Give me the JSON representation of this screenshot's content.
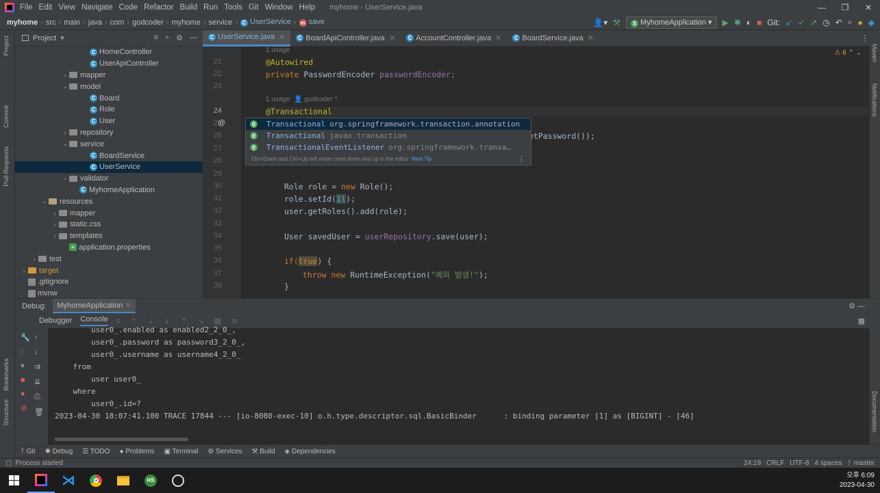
{
  "titlebar": {
    "menu": [
      "File",
      "Edit",
      "View",
      "Navigate",
      "Code",
      "Refactor",
      "Build",
      "Run",
      "Tools",
      "Git",
      "Window",
      "Help"
    ],
    "window_title": "myhome - UserService.java"
  },
  "breadcrumbs": [
    "myhome",
    "src",
    "main",
    "java",
    "com",
    "godcoder",
    "myhome",
    "service",
    "UserService",
    "save"
  ],
  "toolbar": {
    "run_config": "MyhomeApplication",
    "git_label": "Git:"
  },
  "left_stripe": {
    "project": "Project",
    "commit": "Commit",
    "pull_requests": "Pull Requests",
    "bookmarks": "Bookmarks",
    "structure": "Structure"
  },
  "right_stripe": {
    "maven": "Maven",
    "notifications": "Notifications",
    "documentation": "Documentation"
  },
  "project_panel": {
    "title": "Project",
    "items": [
      {
        "label": "HomeController",
        "icon": "class",
        "indent": 7
      },
      {
        "label": "UserApiController",
        "icon": "class",
        "indent": 7
      },
      {
        "label": "mapper",
        "icon": "folder",
        "indent": 5,
        "arrow": "›"
      },
      {
        "label": "model",
        "icon": "folder",
        "indent": 5,
        "arrow": "⌄"
      },
      {
        "label": "Board",
        "icon": "class",
        "indent": 7
      },
      {
        "label": "Role",
        "icon": "class",
        "indent": 7
      },
      {
        "label": "User",
        "icon": "class",
        "indent": 7
      },
      {
        "label": "repository",
        "icon": "folder",
        "indent": 5,
        "arrow": "›"
      },
      {
        "label": "service",
        "icon": "folder",
        "indent": 5,
        "arrow": "⌄"
      },
      {
        "label": "BoardService",
        "icon": "class",
        "indent": 7
      },
      {
        "label": "UserService",
        "icon": "class",
        "indent": 7,
        "selected": true
      },
      {
        "label": "validator",
        "icon": "folder",
        "indent": 5,
        "arrow": "›"
      },
      {
        "label": "MyhomeApplication",
        "icon": "app",
        "indent": 6
      },
      {
        "label": "resources",
        "icon": "resfolder",
        "indent": 3,
        "arrow": "⌄"
      },
      {
        "label": "mapper",
        "icon": "folder",
        "indent": 4,
        "arrow": "›"
      },
      {
        "label": "static.css",
        "icon": "folder",
        "indent": 4,
        "arrow": "›"
      },
      {
        "label": "templates",
        "icon": "folder",
        "indent": 4,
        "arrow": "›"
      },
      {
        "label": "application.properties",
        "icon": "props",
        "indent": 5
      },
      {
        "label": "test",
        "icon": "folder",
        "indent": 2,
        "arrow": "›"
      },
      {
        "label": "target",
        "icon": "tgtfolder",
        "indent": 1,
        "arrow": "›"
      },
      {
        "label": ".gitignore",
        "icon": "file",
        "indent": 1
      },
      {
        "label": "mvnw",
        "icon": "file",
        "indent": 1
      }
    ]
  },
  "editor": {
    "tabs": [
      {
        "label": "UserService.java",
        "active": true
      },
      {
        "label": "BoardApiController.java"
      },
      {
        "label": "AccountController.java"
      },
      {
        "label": "BoardService.java"
      }
    ],
    "warnings": "6",
    "hint_usage": "1 usage",
    "hint_usage2": "1 usage",
    "hint_author": "godcoder *",
    "line_numbers": [
      "21",
      "22",
      "23",
      "24",
      "25",
      "26",
      "27",
      "28",
      "29",
      "30",
      "31",
      "32",
      "33",
      "34",
      "35",
      "36",
      "37",
      "38"
    ],
    "code": {
      "l21": "@Autowired",
      "l22_kw": "private ",
      "l22_type": "PasswordEncoder ",
      "l22_field": "passwordEncoder;",
      "l24": "@Transactional",
      "l26_tail": "etPassword());",
      "l30_a": "Role role = ",
      "l30_kw": "new ",
      "l30_b": "Role();",
      "l31_a": "role.setId(",
      "l31_num": "1l",
      "l31_b": ");",
      "l32": "user.getRoles().add(role);",
      "l34_a": "User savedUser = ",
      "l34_field": "userRepository",
      "l34_b": ".save(user);",
      "l36_kw": "if(",
      "l36_kw2": "true",
      "l36_b": ") {",
      "l37_kw": "throw new ",
      "l37_a": "RuntimeException(",
      "l37_str": "\"예외 발생!\"",
      "l37_b": ");",
      "l38": "}"
    }
  },
  "completion_popup": {
    "items": [
      {
        "name": "Transactional",
        "pkg": "org.springframework.transaction.annotation",
        "selected": true
      },
      {
        "name": "Transactional",
        "pkg": "javax.transaction"
      },
      {
        "name": "TransactionalEventListener",
        "pkg": "org.springframework.transa…"
      }
    ],
    "footer": "Ctrl+Down and Ctrl+Up will move caret down and up in the editor",
    "next_tip": "Next Tip"
  },
  "debug": {
    "label": "Debug:",
    "config": "MyhomeApplication",
    "tabs": [
      "Debugger",
      "Console"
    ],
    "console_lines": [
      "        user0_.enabled as enabled2_2_0_,",
      "        user0_.password as password3_2_0_,",
      "        user0_.username as username4_2_0_",
      "    from",
      "        user user0_",
      "    where",
      "        user0_.id=?",
      "2023-04-30 18:07:41.100 TRACE 17844 --- [io-8080-exec-10] o.h.type.descriptor.sql.BasicBinder      : binding parameter [1] as [BIGINT] - [46]"
    ]
  },
  "bottom_tabs": [
    "Git",
    "Debug",
    "TODO",
    "Problems",
    "Terminal",
    "Services",
    "Build",
    "Dependencies"
  ],
  "status": {
    "left": "Process started",
    "position": "24:19",
    "line_sep": "CRLF",
    "encoding": "UTF-8",
    "indent": "4 spaces",
    "branch": "master"
  },
  "taskbar": {
    "time": "오후 6:09",
    "date": "2023-04-30"
  }
}
